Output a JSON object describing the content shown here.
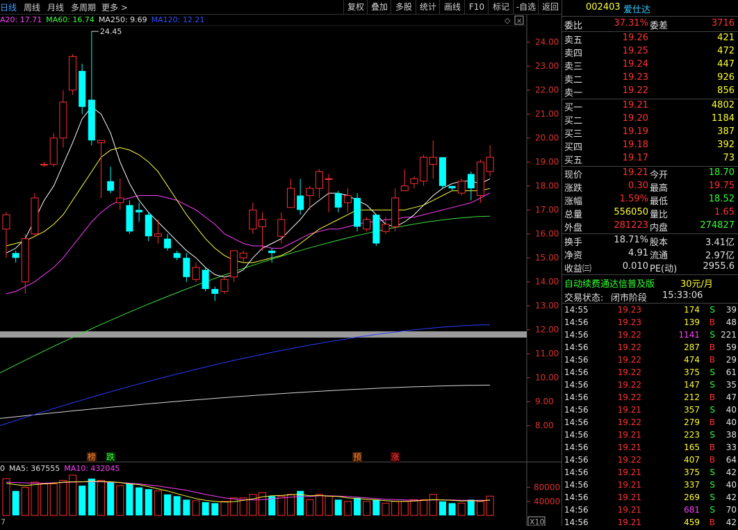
{
  "topbar": {
    "tabs": [
      "日线",
      "周线",
      "月线",
      "多周期",
      "更多 >"
    ],
    "buttons": [
      "复权",
      "叠加",
      "多股",
      "统计",
      "画线",
      "F10",
      "标记",
      "-自选",
      "返回"
    ]
  },
  "ma_legend": [
    {
      "text": "A20: 17.71",
      "color": "#ff40ff"
    },
    {
      "text": "MA60: 16.74",
      "color": "#40ff40"
    },
    {
      "text": "MA250: 9.69",
      "color": "#e0e0e0"
    },
    {
      "text": "MA120: 12.21",
      "color": "#3050ff"
    }
  ],
  "price_axis": [
    "24.00",
    "23.00",
    "22.00",
    "21.00",
    "20.00",
    "19.00",
    "18.00",
    "17.00",
    "16.00",
    "15.00",
    "14.00",
    "13.00",
    "12.00",
    "11.00",
    "10.00",
    "9.00",
    "8.00"
  ],
  "high_annotation": "24.45",
  "markers": [
    {
      "text": "榜",
      "color": "#ff8040",
      "bg": "#402000"
    },
    {
      "text": "跌",
      "color": "#40ff40",
      "bg": "#003000"
    },
    {
      "text": "预",
      "color": "#ff8040",
      "bg": "#402000"
    },
    {
      "text": "涨",
      "color": "#ff4040",
      "bg": "#400000"
    }
  ],
  "vol_legend": [
    {
      "text": "0",
      "color": "#e0e0e0"
    },
    {
      "text": "MA5: 367555",
      "color": "#e0e0e0"
    },
    {
      "text": "MA10: 432045",
      "color": "#ff40ff"
    }
  ],
  "vol_axis": [
    "80000",
    "40000"
  ],
  "vol_unit": "X10",
  "bottom_left": "7",
  "chart_data": {
    "type": "candlestick",
    "ylim": [
      7.5,
      24.6
    ],
    "candles": [
      [
        16.2,
        16.8,
        15.0,
        16.9
      ],
      [
        15.2,
        15.0,
        14.8,
        15.3
      ],
      [
        14.0,
        15.8,
        13.5,
        16.0
      ],
      [
        16.0,
        17.5,
        15.9,
        17.7
      ],
      [
        18.9,
        18.9,
        18.8,
        19.0
      ],
      [
        18.9,
        20.0,
        18.8,
        20.2
      ],
      [
        20.0,
        21.5,
        19.6,
        22.0
      ],
      [
        22.0,
        23.4,
        21.8,
        23.5
      ],
      [
        22.8,
        21.3,
        21.0,
        23.1
      ],
      [
        21.6,
        19.9,
        19.7,
        24.45
      ],
      [
        19.8,
        19.9,
        17.5,
        19.9
      ],
      [
        18.2,
        17.8,
        17.7,
        18.8
      ],
      [
        17.3,
        17.5,
        17.0,
        18.3
      ],
      [
        17.2,
        16.1,
        16.0,
        17.4
      ],
      [
        17.0,
        16.9,
        16.5,
        17.3
      ],
      [
        16.8,
        15.9,
        15.7,
        16.9
      ],
      [
        15.9,
        16.0,
        15.6,
        16.6
      ],
      [
        15.8,
        15.4,
        15.3,
        16.0
      ],
      [
        15.2,
        15.0,
        14.9,
        15.3
      ],
      [
        15.0,
        14.2,
        14.0,
        15.2
      ],
      [
        14.1,
        14.6,
        14.0,
        14.8
      ],
      [
        14.5,
        13.7,
        13.6,
        14.6
      ],
      [
        13.7,
        13.5,
        13.2,
        13.8
      ],
      [
        13.6,
        14.1,
        13.5,
        14.2
      ],
      [
        14.2,
        15.3,
        14.0,
        15.3
      ],
      [
        15.0,
        15.2,
        14.8,
        15.3
      ],
      [
        16.2,
        17.0,
        16.0,
        17.3
      ],
      [
        16.3,
        16.6,
        15.3,
        16.9
      ],
      [
        15.3,
        15.2,
        14.8,
        15.4
      ],
      [
        15.9,
        16.6,
        15.6,
        16.9
      ],
      [
        17.1,
        17.9,
        17.1,
        18.3
      ],
      [
        17.6,
        17.0,
        16.8,
        18.3
      ],
      [
        17.6,
        17.9,
        17.0,
        18.0
      ],
      [
        17.9,
        18.6,
        17.5,
        18.7
      ],
      [
        18.3,
        18.3,
        16.9,
        18.5
      ],
      [
        17.7,
        17.1,
        16.9,
        17.8
      ],
      [
        17.3,
        17.6,
        16.9,
        17.9
      ],
      [
        17.5,
        16.3,
        16.1,
        17.7
      ],
      [
        16.2,
        16.6,
        16.1,
        16.7
      ],
      [
        16.8,
        15.6,
        15.5,
        16.8
      ],
      [
        16.1,
        16.4,
        16.0,
        16.7
      ],
      [
        16.3,
        17.5,
        16.1,
        17.9
      ],
      [
        17.8,
        18.0,
        17.8,
        18.7
      ],
      [
        18.1,
        18.3,
        17.9,
        18.4
      ],
      [
        18.2,
        19.2,
        18.0,
        19.3
      ],
      [
        18.9,
        19.2,
        18.3,
        19.9
      ],
      [
        19.2,
        18.0,
        17.9,
        19.2
      ],
      [
        18.0,
        17.9,
        17.8,
        18.0
      ],
      [
        17.7,
        18.2,
        17.6,
        18.3
      ],
      [
        18.5,
        17.9,
        17.4,
        18.6
      ],
      [
        17.6,
        19.0,
        17.3,
        19.1
      ],
      [
        18.6,
        19.2,
        18.4,
        19.7
      ]
    ],
    "volumes": [
      105000,
      70000,
      80000,
      95000,
      90000,
      90000,
      100000,
      115000,
      85000,
      105000,
      100000,
      95000,
      85000,
      90000,
      80000,
      75000,
      70000,
      60000,
      55000,
      45000,
      42000,
      38000,
      35000,
      40000,
      50000,
      50000,
      60000,
      65000,
      55000,
      55000,
      60000,
      70000,
      45000,
      60000,
      55000,
      45000,
      40000,
      50000,
      40000,
      45000,
      35000,
      40000,
      40000,
      45000,
      45000,
      60000,
      40000,
      35000,
      35000,
      45000,
      40000,
      55000
    ],
    "ma5_vol": [
      92000,
      88000,
      85000,
      88000,
      90000,
      92000,
      95000,
      96000,
      96000,
      98000,
      97000,
      96000,
      94000,
      90000,
      88000,
      82000,
      76000,
      70000,
      62000,
      55000,
      48000,
      43000,
      40000,
      38000,
      39000,
      43000,
      47000,
      53000,
      56000,
      57000,
      59000,
      60000,
      56000,
      57000,
      55000,
      54000,
      50000,
      48000,
      46000,
      44000,
      42000,
      40000,
      40000,
      41000,
      43000,
      45000,
      44000,
      43000,
      41000,
      42000,
      41000,
      44000
    ],
    "ma10_vol": [
      95000,
      94000,
      93000,
      92000,
      92000,
      93000,
      94000,
      95000,
      96000,
      96000,
      96000,
      95000,
      94000,
      92000,
      90000,
      87000,
      84000,
      80000,
      76000,
      72000,
      66000,
      60000,
      55000,
      50000,
      47000,
      45000,
      44000,
      45000,
      47000,
      50000,
      52000,
      54000,
      54000,
      56000,
      56000,
      55000,
      54000,
      52000,
      50000,
      48000,
      46000,
      45000,
      44000,
      43000,
      43000,
      44000,
      44000,
      44000,
      43000,
      43000,
      43000,
      43000
    ],
    "ma5": [
      15.2,
      15.4,
      15.8,
      16.6,
      17.4,
      18.0,
      18.9,
      19.8,
      20.8,
      21.3,
      21.0,
      20.2,
      19.0,
      18.1,
      17.4,
      16.9,
      16.5,
      16.1,
      15.7,
      15.3,
      15.0,
      14.6,
      14.3,
      14.2,
      14.3,
      14.5,
      15.0,
      15.4,
      15.6,
      15.8,
      16.2,
      16.6,
      17.1,
      17.4,
      17.7,
      17.7,
      17.6,
      17.4,
      17.2,
      16.8,
      16.4,
      16.3,
      16.5,
      16.8,
      17.2,
      17.6,
      17.9,
      18.1,
      18.2,
      18.2,
      18.1,
      18.3
    ],
    "ma10": [
      15.5,
      15.6,
      15.7,
      15.9,
      16.1,
      16.4,
      16.8,
      17.4,
      18.0,
      18.6,
      19.2,
      19.5,
      19.6,
      19.5,
      19.3,
      19.0,
      18.6,
      18.0,
      17.4,
      16.8,
      16.3,
      15.8,
      15.4,
      15.1,
      14.9,
      14.8,
      14.8,
      14.9,
      15.0,
      15.1,
      15.3,
      15.6,
      15.9,
      16.2,
      16.4,
      16.6,
      16.8,
      17.0,
      17.0,
      17.0,
      17.0,
      17.0,
      17.0,
      17.1,
      17.2,
      17.4,
      17.6,
      17.8,
      17.8,
      17.8,
      17.8,
      17.9
    ],
    "ma20": [
      13.5,
      13.6,
      13.8,
      14.0,
      14.3,
      14.6,
      15.0,
      15.5,
      16.0,
      16.5,
      16.9,
      17.2,
      17.4,
      17.5,
      17.6,
      17.6,
      17.6,
      17.5,
      17.4,
      17.2,
      17.0,
      16.7,
      16.4,
      16.0,
      15.8,
      15.6,
      15.5,
      15.5,
      15.4,
      15.4,
      15.6,
      15.8,
      16.0,
      16.1,
      16.2,
      16.2,
      16.3,
      16.4,
      16.5,
      16.5,
      16.6,
      16.6,
      16.7,
      16.7,
      16.8,
      16.9,
      17.0,
      17.1,
      17.2,
      17.3,
      17.5,
      17.71
    ],
    "ma60_range": [
      10.2,
      16.74
    ],
    "ma120_range": [
      8.0,
      12.21
    ],
    "ma250_range": [
      8.3,
      9.69
    ]
  },
  "panel": {
    "code": "002403",
    "name": "爱仕达",
    "weibi_label": "委比",
    "weibi": "37.31%",
    "weicha_label": "委差",
    "weicha": "3716",
    "asks": [
      {
        "label": "卖五",
        "price": "19.26",
        "vol": "421"
      },
      {
        "label": "卖四",
        "price": "19.25",
        "vol": "472"
      },
      {
        "label": "卖三",
        "price": "19.24",
        "vol": "447"
      },
      {
        "label": "卖二",
        "price": "19.23",
        "vol": "926"
      },
      {
        "label": "卖一",
        "price": "19.22",
        "vol": "856"
      }
    ],
    "bids": [
      {
        "label": "买一",
        "price": "19.21",
        "vol": "4802"
      },
      {
        "label": "买二",
        "price": "19.20",
        "vol": "1184"
      },
      {
        "label": "买三",
        "price": "19.19",
        "vol": "387"
      },
      {
        "label": "买四",
        "price": "19.18",
        "vol": "392"
      },
      {
        "label": "买五",
        "price": "19.17",
        "vol": "73"
      }
    ],
    "stats": [
      {
        "l1": "现价",
        "v1": "19.21",
        "c1": "red",
        "l2": "今开",
        "v2": "18.70",
        "c2": "green"
      },
      {
        "l1": "涨跌",
        "v1": "0.30",
        "c1": "red",
        "l2": "最高",
        "v2": "19.75",
        "c2": "red"
      },
      {
        "l1": "涨幅",
        "v1": "1.59%",
        "c1": "red",
        "l2": "最低",
        "v2": "18.52",
        "c2": "green"
      },
      {
        "l1": "总量",
        "v1": "556050",
        "c1": "yellow",
        "l2": "量比",
        "v2": "1.65",
        "c2": "red"
      },
      {
        "l1": "外盘",
        "v1": "281223",
        "c1": "red",
        "l2": "内盘",
        "v2": "274827",
        "c2": "green"
      }
    ],
    "stats2": [
      {
        "l1": "换手",
        "v1": "18.71%",
        "l2": "股本",
        "v2": "3.41亿"
      },
      {
        "l1": "净资",
        "v1": "4.91",
        "l2": "流通",
        "v2": "2.97亿"
      },
      {
        "l1": "收益㈢",
        "v1": "0.010",
        "l2": "PE(动)",
        "v2": "2955.6"
      }
    ],
    "promo": "自动续费通达信普及版",
    "promo_price": "30元/月",
    "trade_status_label": "交易状态:",
    "trade_status": "闭市阶段",
    "trade_time": "15:33:06",
    "ticks": [
      {
        "t": "14:55",
        "p": "19.23",
        "v": "174",
        "s": "S",
        "n": "39"
      },
      {
        "t": "14:56",
        "p": "19.23",
        "v": "139",
        "s": "B",
        "n": "48"
      },
      {
        "t": "14:56",
        "p": "19.22",
        "v": "1141",
        "s": "S",
        "n": "221"
      },
      {
        "t": "14:56",
        "p": "19.22",
        "v": "287",
        "s": "B",
        "n": "59"
      },
      {
        "t": "14:56",
        "p": "19.22",
        "v": "474",
        "s": "B",
        "n": "29"
      },
      {
        "t": "14:56",
        "p": "19.22",
        "v": "375",
        "s": "S",
        "n": "61"
      },
      {
        "t": "14:56",
        "p": "19.22",
        "v": "147",
        "s": "S",
        "n": "35"
      },
      {
        "t": "14:56",
        "p": "19.22",
        "v": "212",
        "s": "B",
        "n": "47"
      },
      {
        "t": "14:56",
        "p": "19.21",
        "v": "357",
        "s": "S",
        "n": "40"
      },
      {
        "t": "14:56",
        "p": "19.22",
        "v": "279",
        "s": "B",
        "n": "40"
      },
      {
        "t": "14:56",
        "p": "19.21",
        "v": "223",
        "s": "S",
        "n": "38"
      },
      {
        "t": "14:56",
        "p": "19.21",
        "v": "165",
        "s": "B",
        "n": "33"
      },
      {
        "t": "14:56",
        "p": "19.22",
        "v": "407",
        "s": "B",
        "n": "64"
      },
      {
        "t": "14:56",
        "p": "19.21",
        "v": "375",
        "s": "S",
        "n": "42"
      },
      {
        "t": "14:56",
        "p": "19.21",
        "v": "337",
        "s": "S",
        "n": "40"
      },
      {
        "t": "14:56",
        "p": "19.21",
        "v": "269",
        "s": "S",
        "n": "42"
      },
      {
        "t": "14:56",
        "p": "19.21",
        "v": "681",
        "s": "S",
        "n": "70"
      },
      {
        "t": "14:56",
        "p": "19.21",
        "v": "459",
        "s": "B",
        "n": "42"
      }
    ]
  }
}
